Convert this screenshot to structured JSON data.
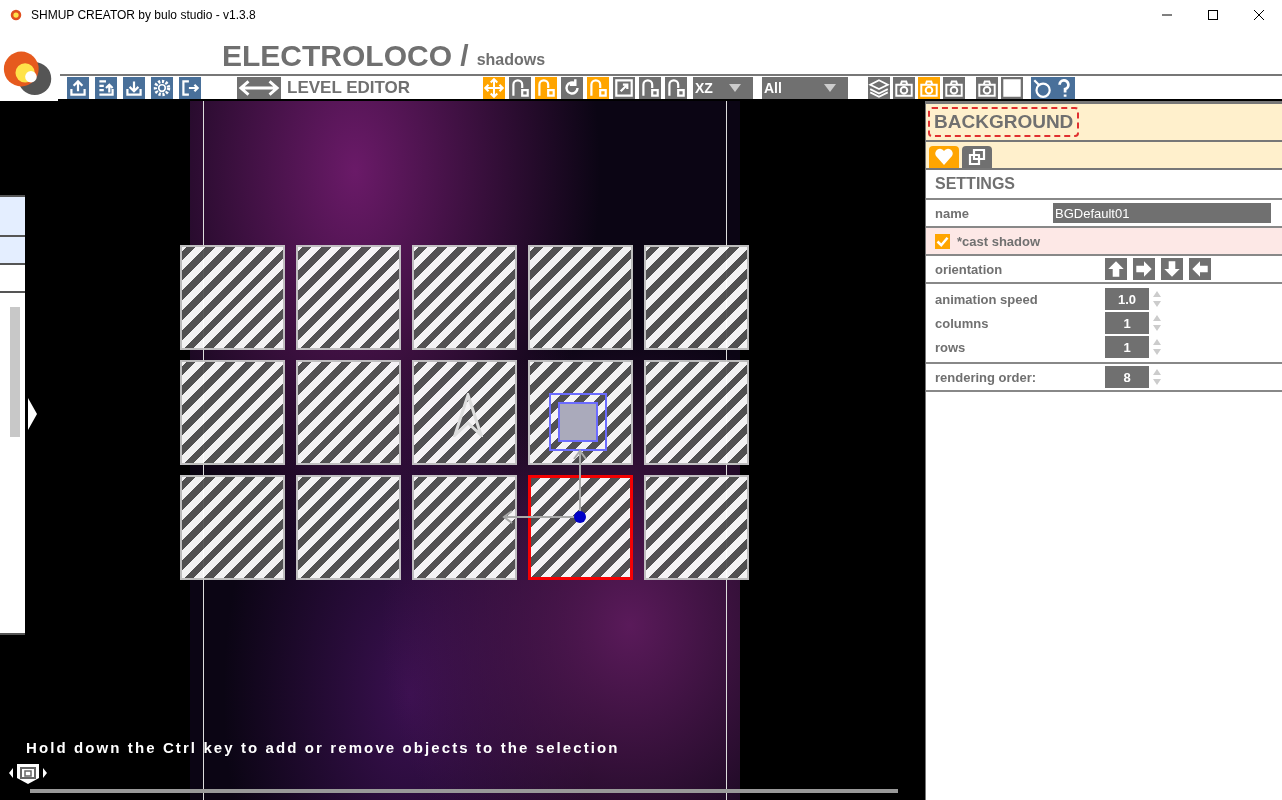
{
  "window": {
    "title": "SHMUP CREATOR by bulo studio - v1.3.8"
  },
  "project": {
    "name": "ELECTROLOCO /",
    "level": "shadows"
  },
  "toolbar": {
    "mode": "LEVEL EDITOR",
    "tools": [
      {
        "on": true
      },
      {
        "on": false
      },
      {
        "on": true
      },
      {
        "on": false
      },
      {
        "on": true
      },
      {
        "on": false
      },
      {
        "on": false
      },
      {
        "on": false
      }
    ],
    "axis": "XZ",
    "filter": "All",
    "view_tools": [
      {
        "on": false
      },
      {
        "on": false
      },
      {
        "on": true
      },
      {
        "on": false
      },
      {
        "on": false
      },
      {
        "on": false
      }
    ]
  },
  "canvas": {
    "side_items": [
      {
        "selected": true
      },
      {
        "selected": true
      },
      {
        "selected": false
      }
    ],
    "tiles": [
      {
        "selected": false
      },
      {
        "selected": false
      },
      {
        "selected": false
      },
      {
        "selected": false
      },
      {
        "selected": false
      },
      {
        "selected": false
      },
      {
        "selected": false
      },
      {
        "selected": false
      },
      {
        "selected": false
      },
      {
        "selected": false
      },
      {
        "selected": false
      },
      {
        "selected": false
      },
      {
        "selected": false
      },
      {
        "selected": true
      },
      {
        "selected": false
      }
    ],
    "hint": "Hold down the Ctrl key to add or remove objects to the selection"
  },
  "panel": {
    "title": "BACKGROUND",
    "tabs": [
      {
        "selected": true
      },
      {
        "selected": false
      }
    ],
    "section": "SETTINGS",
    "name_label": "name",
    "name_value": "BGDefault01",
    "cast_shadow": {
      "label": "*cast shadow",
      "checked": true
    },
    "orientation_label": "orientation",
    "spinners": [
      {
        "label": "animation speed",
        "value": "1.0"
      },
      {
        "label": "columns",
        "value": "1"
      },
      {
        "label": "rows",
        "value": "1"
      }
    ],
    "rendering": {
      "label": "rendering order:",
      "value": "8"
    }
  }
}
